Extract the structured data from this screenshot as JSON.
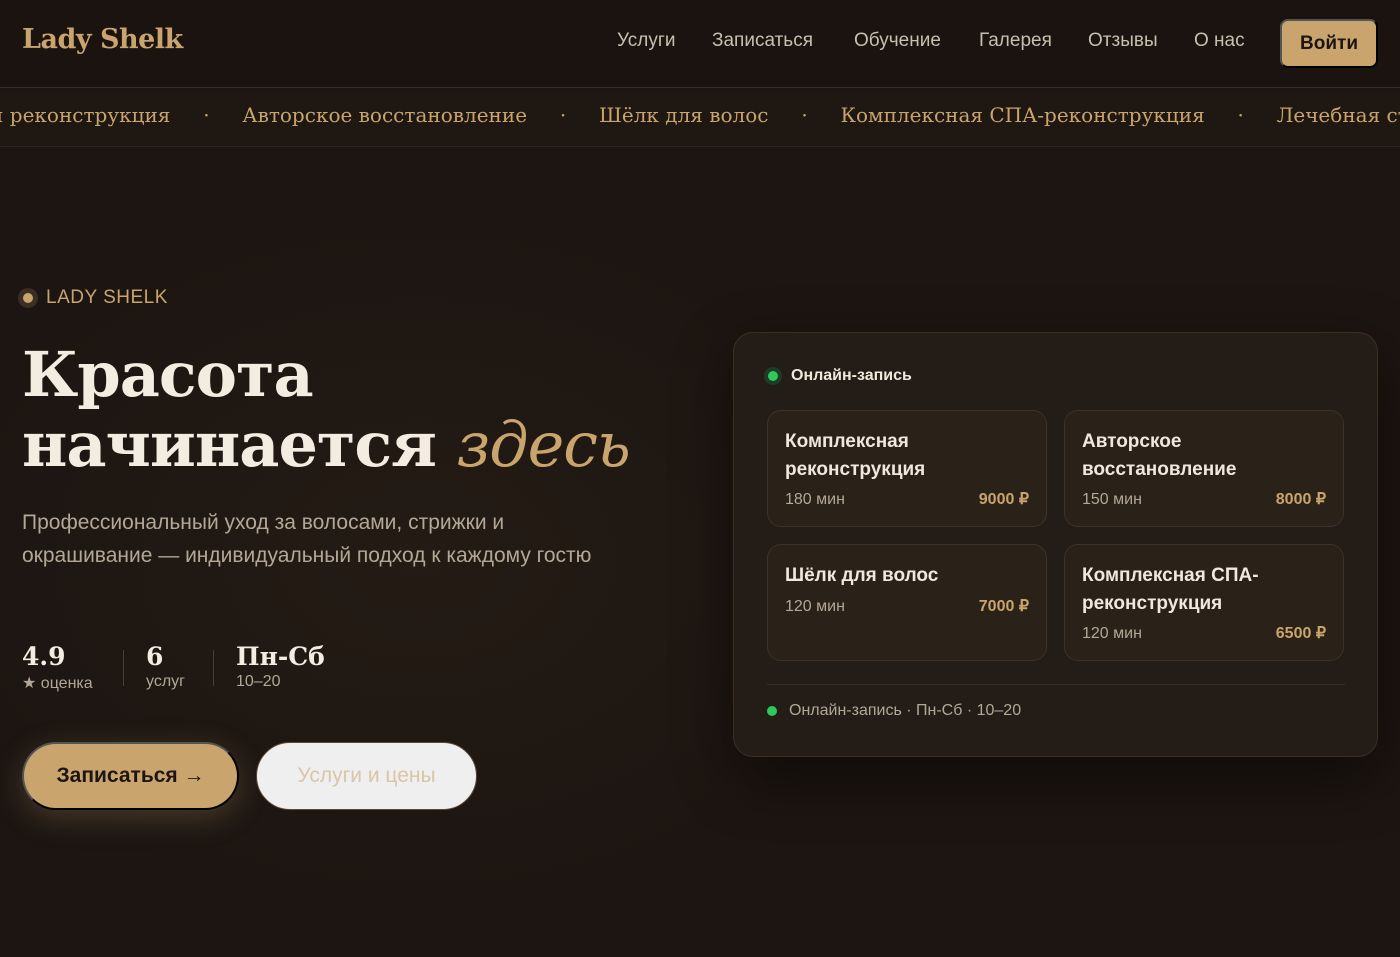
{
  "brand": {
    "logo": "Lady Shelk"
  },
  "nav": {
    "links": [
      "Услуги",
      "Записаться",
      "Обучение",
      "Галерея",
      "Отзывы",
      "О нас"
    ],
    "login_label": "Войти"
  },
  "ticker": {
    "items": [
      "ексная реконструкция",
      "Авторское восстановление",
      "Шёлк для волос",
      "Комплексная СПА-реконструкция",
      "Лечебная стр"
    ],
    "separator": "·"
  },
  "hero": {
    "eyebrow": "LADY SHELK",
    "headline_line1": "Красота",
    "headline_line2": "начинается",
    "headline_accent": "здесь",
    "subtitle": "Профессиональный уход за волосами, стрижки и окрашивание — индивидуальный подход к каждому гостю",
    "stats": [
      {
        "value": "4.9",
        "label": "★ оценка"
      },
      {
        "value": "6",
        "label": "услуг"
      },
      {
        "value": "Пн-Сб",
        "label": "10–20"
      }
    ],
    "primary_button": "Записаться →",
    "secondary_button": "Услуги и цены"
  },
  "booking_card": {
    "title": "Онлайн-запись",
    "services": [
      {
        "name": "Комплексная реконструкция",
        "duration": "180 мин",
        "price": "9000 ₽"
      },
      {
        "name": "Авторское восстановление",
        "duration": "150 мин",
        "price": "8000 ₽"
      },
      {
        "name": "Шёлк для волос",
        "duration": "120 мин",
        "price": "7000 ₽"
      },
      {
        "name": "Комплексная СПА-реконструкция",
        "duration": "120 мин",
        "price": "6500 ₽"
      }
    ],
    "footer": "Онлайн-запись · Пн-Сб · 10–20"
  },
  "colors": {
    "background": "#1c1511",
    "accent": "#c9a46c",
    "online_status": "#2fc85a"
  }
}
